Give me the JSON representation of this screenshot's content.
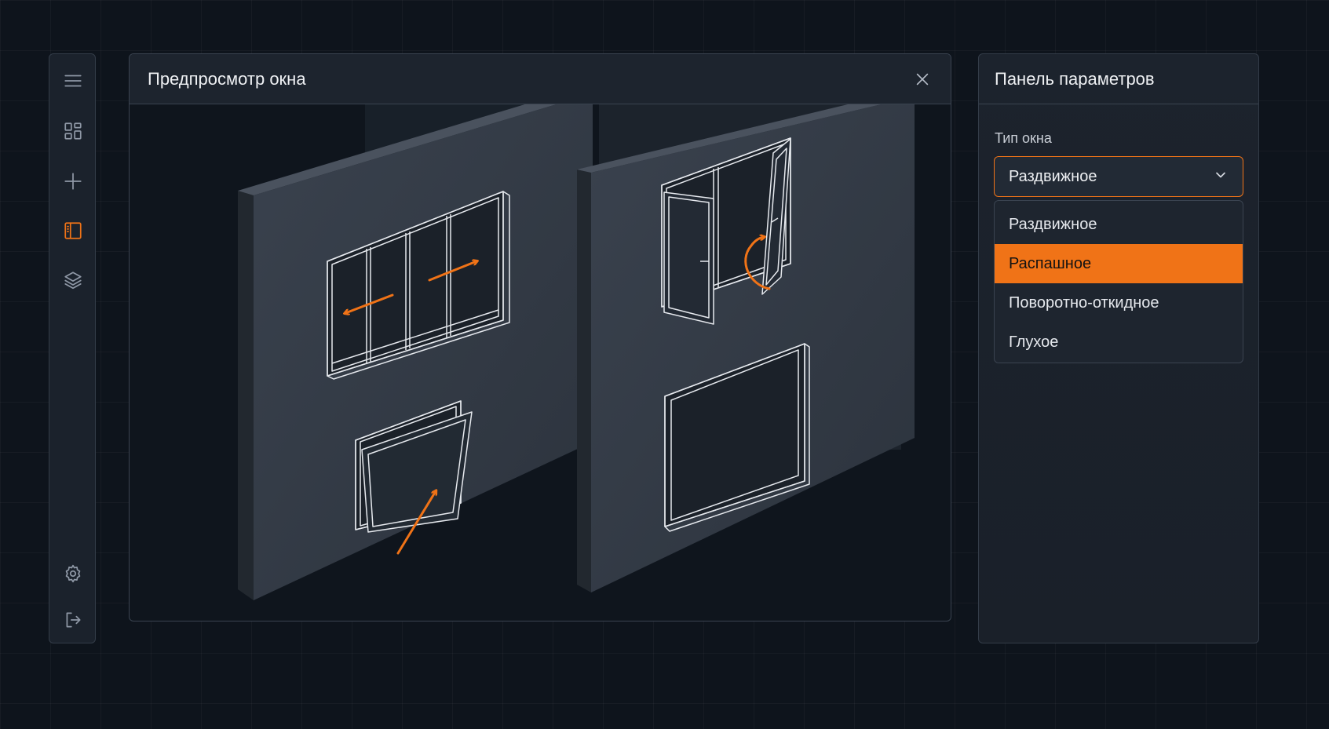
{
  "sidebar": {
    "icons": [
      {
        "name": "menu-icon"
      },
      {
        "name": "dashboard-icon"
      },
      {
        "name": "add-icon"
      },
      {
        "name": "window-panel-icon",
        "active": true
      },
      {
        "name": "layers-icon"
      },
      {
        "name": "settings-icon"
      },
      {
        "name": "logout-icon"
      }
    ]
  },
  "preview": {
    "title": "Предпросмотр окна",
    "close_icon": "close-icon",
    "window_types": [
      "sliding",
      "casement",
      "tilt",
      "fixed"
    ]
  },
  "params": {
    "title": "Панель параметров",
    "field_label": "Тип окна",
    "select_value": "Раздвижное",
    "options": [
      "Раздвижное",
      "Распашное",
      "Поворотно-откидное",
      "Глухое"
    ],
    "highlighted_option": "Распашное"
  },
  "colors": {
    "accent": "#f07317",
    "background": "#0e141c",
    "panel": "#1b222c",
    "wall": "#353d48"
  }
}
